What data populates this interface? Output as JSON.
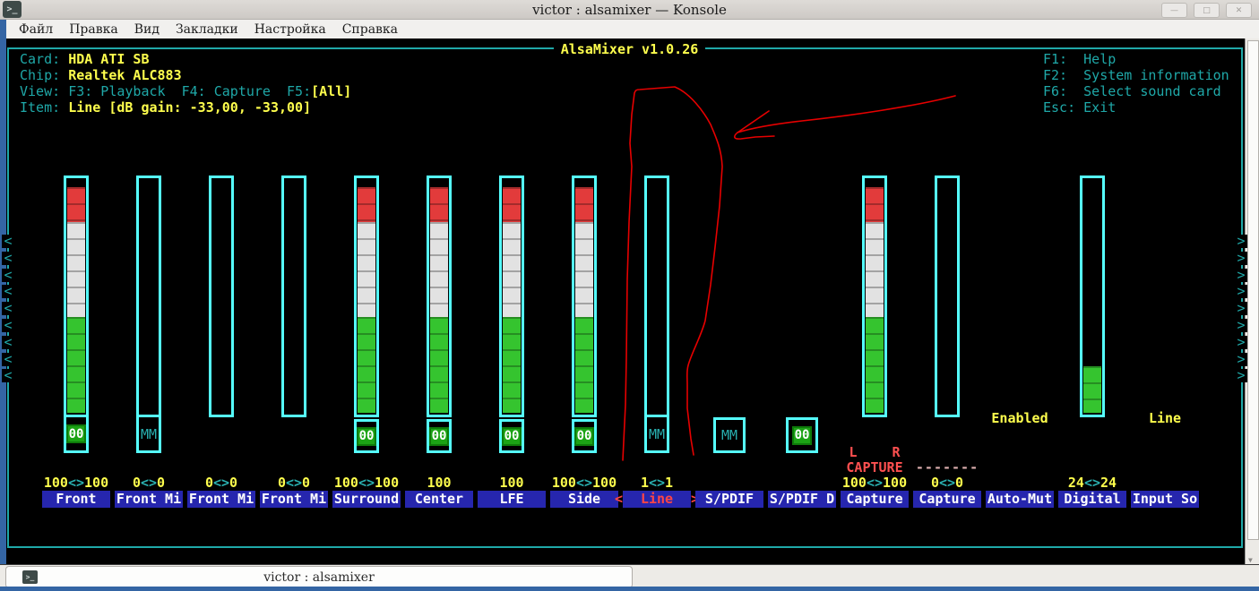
{
  "window": {
    "title": "victor : alsamixer — Konsole",
    "buttons": [
      {
        "name": "minimize",
        "glyph": "—"
      },
      {
        "name": "maximize",
        "glyph": "□"
      },
      {
        "name": "close",
        "glyph": "✕"
      }
    ]
  },
  "menu": {
    "items": [
      "Файл",
      "Правка",
      "Вид",
      "Закладки",
      "Настройка",
      "Справка"
    ]
  },
  "mixer": {
    "title": "AlsaMixer v1.0.26",
    "info": {
      "card_label": "Card: ",
      "card": "HDA ATI SB",
      "chip_label": "Chip: ",
      "chip": "Realtek ALC883",
      "view_label": "View: ",
      "view": "F3: Playback  F4: Capture  F5:",
      "view_mode": "[All]",
      "item_label": "Item: ",
      "item": "Line [dB gain: -33,00, -33,00]"
    },
    "help": [
      "F1:  Help",
      "F2:  System information",
      "F6:  Select sound card",
      "Esc: Exit"
    ],
    "value_separator": "<>",
    "selected_arrows": {
      "left": "<",
      "right": ">"
    },
    "capture_lr": {
      "left": "L",
      "right": "R"
    },
    "scroll": {
      "left": "<",
      "right": ">"
    },
    "channels": [
      {
        "name": "Front",
        "bar": "full",
        "mute": "00",
        "connected": true,
        "values": [
          "100",
          "100"
        ]
      },
      {
        "name": "Front Mi",
        "bar": "empty",
        "mute": "MM",
        "connected": true,
        "values": [
          "0",
          "0"
        ]
      },
      {
        "name": "Front Mi",
        "bar": "empty",
        "values": [
          "0",
          "0"
        ]
      },
      {
        "name": "Front Mi",
        "bar": "empty",
        "values": [
          "0",
          "0"
        ]
      },
      {
        "name": "Surround",
        "bar": "full",
        "mute": "00",
        "values": [
          "100",
          "100"
        ]
      },
      {
        "name": "Center",
        "bar": "full",
        "mute": "00",
        "values": [
          "100"
        ]
      },
      {
        "name": "LFE",
        "bar": "full",
        "mute": "00",
        "values": [
          "100"
        ]
      },
      {
        "name": "Side",
        "bar": "full",
        "mute": "00",
        "values": [
          "100",
          "100"
        ]
      },
      {
        "name": "Line",
        "bar": "empty",
        "mute": "MM",
        "connected": true,
        "values": [
          "1",
          "1"
        ],
        "selected": true
      },
      {
        "name": "S/PDIF",
        "mute": "MM"
      },
      {
        "name": "S/PDIF D",
        "mute": "00"
      },
      {
        "name": "Capture",
        "bar": "full",
        "values": [
          "100",
          "100"
        ],
        "capture_text": "CAPTURE",
        "lr": true
      },
      {
        "name": "Capture",
        "bar": "empty",
        "values": [
          "0",
          "0"
        ],
        "capture_text": "-------"
      },
      {
        "name": "Auto-Mut",
        "note": "Enabled"
      },
      {
        "name": "Digital",
        "bar": "partial",
        "fill_pct": 20,
        "values": [
          "24",
          "24"
        ]
      },
      {
        "name": "Input So",
        "note": "Line"
      }
    ]
  },
  "taskbar": {
    "tab_label": "victor : alsamixer"
  },
  "colors": {
    "accent_teal": "#1fa8a8",
    "bright_cyan": "#55ffff",
    "yellow": "#ffff4d",
    "red": "#ff5050",
    "selection_blue": "#2626ae",
    "green": "#1ca315",
    "annotation_red": "#e60000",
    "taskbar_blue": "#3465a4"
  }
}
